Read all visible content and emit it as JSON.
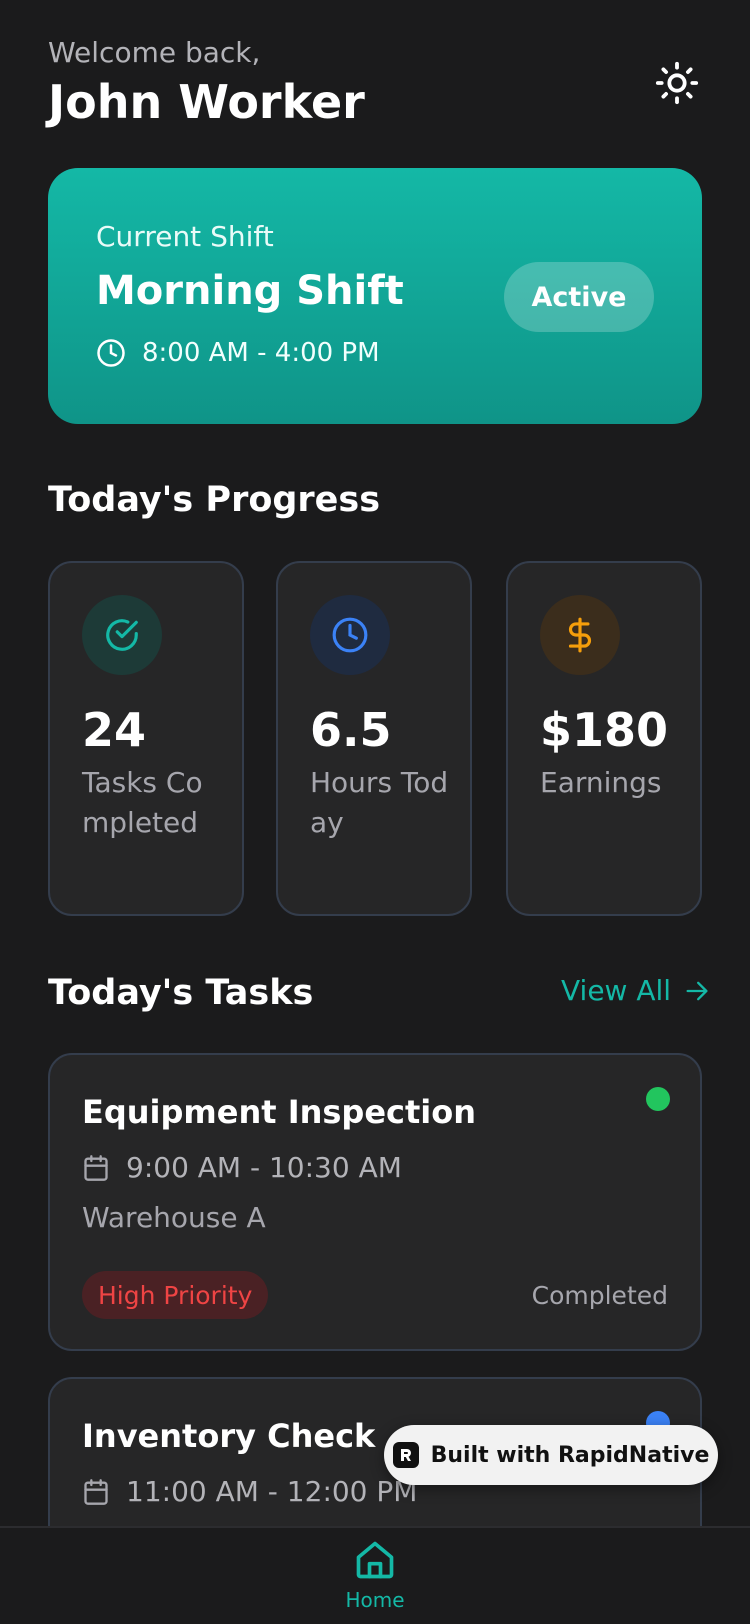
{
  "header": {
    "welcome": "Welcome back,",
    "user_name": "John Worker"
  },
  "shift": {
    "label": "Current Shift",
    "name": "Morning Shift",
    "time": "8:00 AM - 4:00 PM",
    "status": "Active"
  },
  "progress": {
    "title": "Today's Progress",
    "stats": [
      {
        "value": "24",
        "label": "Tasks Completed",
        "icon": "check-circle-icon",
        "color": "#14b8a6"
      },
      {
        "value": "6.5",
        "label": "Hours Today",
        "icon": "clock-icon",
        "color": "#3b82f6"
      },
      {
        "value": "$180",
        "label": "Earnings",
        "icon": "dollar-icon",
        "color": "#f59e0b"
      }
    ]
  },
  "tasks": {
    "title": "Today's Tasks",
    "view_all": "View All",
    "items": [
      {
        "title": "Equipment Inspection",
        "time": "9:00 AM - 10:30 AM",
        "location": "Warehouse A",
        "priority": "High Priority",
        "status": "Completed",
        "dot_color": "#22c55e"
      },
      {
        "title": "Inventory Check",
        "time": "11:00 AM - 12:00 PM",
        "dot_color": "#3b82f6"
      }
    ]
  },
  "badge": {
    "text": "Built with RapidNative"
  },
  "nav": {
    "home_label": "Home"
  },
  "colors": {
    "accent": "#14b8a6",
    "background": "#1b1b1c",
    "card": "#262627"
  }
}
